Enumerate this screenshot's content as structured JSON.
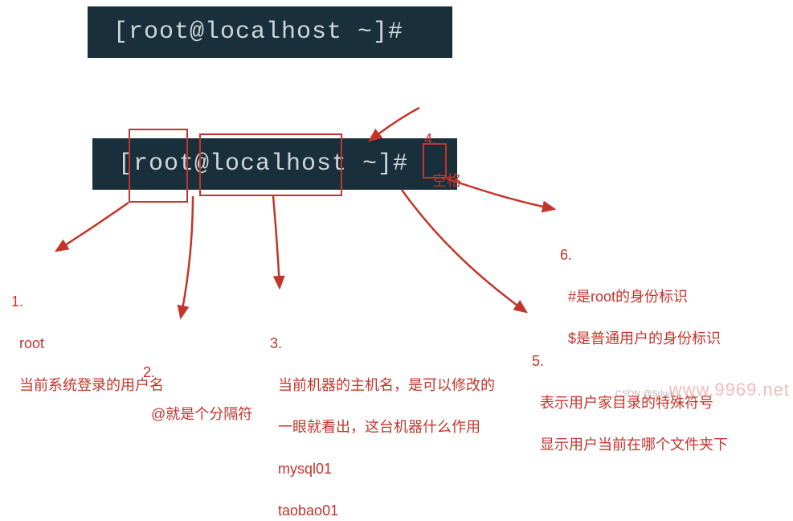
{
  "terminal": {
    "line1": "[root@localhost ~]#",
    "line2": "[root@localhost ~]#"
  },
  "annotations": {
    "a1": {
      "num": "1.",
      "l1": "root",
      "l2": "当前系统登录的用户名"
    },
    "a2": {
      "num": "2.",
      "l1": "@就是个分隔符"
    },
    "a3": {
      "num": "3.",
      "l1": "当前机器的主机名，是可以修改的",
      "l2": "一眼就看出，这台机器什么作用",
      "l3": "mysql01",
      "l4": "taobao01"
    },
    "a4": {
      "num": "4.",
      "l1": "空格"
    },
    "a5": {
      "num": "5.",
      "l1": "表示用户家目录的特殊符号",
      "l2": "显示用户当前在哪个文件夹下"
    },
    "a6": {
      "num": "6.",
      "l1": "#是root的身份标识",
      "l2": "$是普通用户的身份标识"
    }
  },
  "watermarks": {
    "csdn": "CSDN @Srlua",
    "site": "www.9969.net"
  },
  "colors": {
    "red": "#c4342a",
    "terminal_bg": "#19303c",
    "terminal_fg": "#cfd6d9"
  }
}
